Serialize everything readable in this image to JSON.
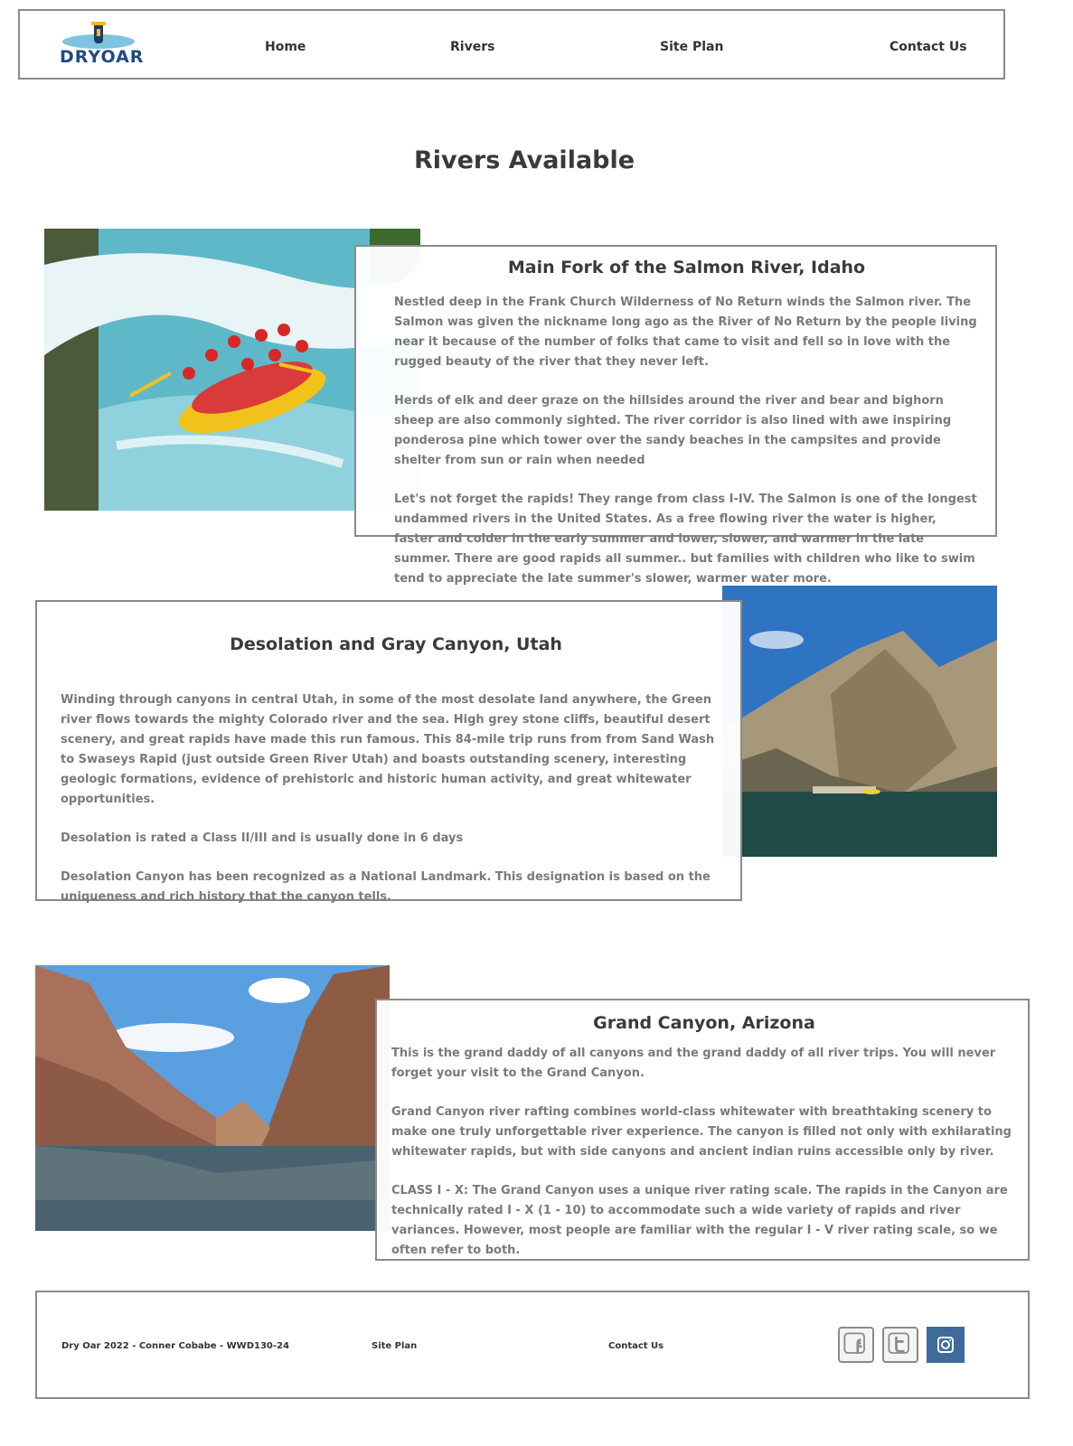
{
  "header": {
    "logo_text": "DRYOAR",
    "nav": [
      {
        "label": "Home"
      },
      {
        "label": "Rivers"
      },
      {
        "label": "Site Plan"
      },
      {
        "label": "Contact Us"
      }
    ]
  },
  "page_title": "Rivers Available",
  "rivers": [
    {
      "title": "Main Fork of the Salmon River, Idaho",
      "paragraphs": [
        "Nestled deep in the Frank Church Wilderness of No Return winds the Salmon river. The Salmon was given the nickname long ago as the River of No Return by the people living near it because of the number of folks that came to visit and fell so in love with the rugged beauty of the river that they never left.",
        "Herds of elk and deer graze on the hillsides around the river and bear and bighorn sheep are also commonly sighted. The river corridor is also lined with awe inspiring ponderosa pine which tower over the sandy beaches in the campsites and provide shelter from sun or rain when needed",
        "Let's not forget the rapids! They range from class I-IV. The Salmon is one of the longest undammed rivers in the United States. As a free flowing river the water is higher, faster and colder in the early summer and lower, slower, and warmer in the late summer. There are good rapids all summer.. but families with children who like to swim tend to appreciate the late summer's slower, warmer water more."
      ]
    },
    {
      "title": "Desolation and Gray Canyon, Utah",
      "paragraphs": [
        "Winding through canyons in central Utah, in some of the most desolate land anywhere, the Green river flows towards the mighty Colorado river and the sea. High grey stone cliffs, beautiful desert scenery, and great rapids have made this run famous. This 84-mile trip runs from from Sand Wash to Swaseys Rapid (just outside Green River Utah) and boasts outstanding scenery, interesting geologic formations, evidence of prehistoric and historic human activity, and great whitewater opportunities.",
        "Desolation is rated a Class II/III and is usually done in 6 days",
        "Desolation Canyon has been recognized as a National Landmark.  This designation is based on the uniqueness and rich history that the canyon tells."
      ]
    },
    {
      "title": "Grand Canyon, Arizona",
      "paragraphs": [
        "This is the grand daddy of all canyons and the grand daddy of all river trips. You will never forget your visit to the Grand Canyon.",
        "Grand Canyon river rafting combines world-class whitewater with breathtaking scenery to make one truly unforgettable river experience. The canyon is filled not only with exhilarating whitewater rapids, but with side canyons and ancient indian ruins accessible only by river.",
        "CLASS I - X: The Grand Canyon uses a unique river rating scale. The rapids in the Canyon are technically rated I - X (1 - 10) to accommodate such a wide variety of rapids and river variances. However, most people are familiar with the regular I - V river rating scale, so we often refer to both."
      ]
    }
  ],
  "footer": {
    "copyright": "Dry Oar 2022 - Conner Cobabe - WWD130-24",
    "site_plan": "Site Plan",
    "contact": "Contact Us",
    "social": [
      {
        "icon": "facebook-icon",
        "color": "#8a8a8a"
      },
      {
        "icon": "twitter-icon",
        "color": "#8a8a8a"
      },
      {
        "icon": "instagram-icon",
        "color": "#3e6b9a"
      }
    ]
  }
}
